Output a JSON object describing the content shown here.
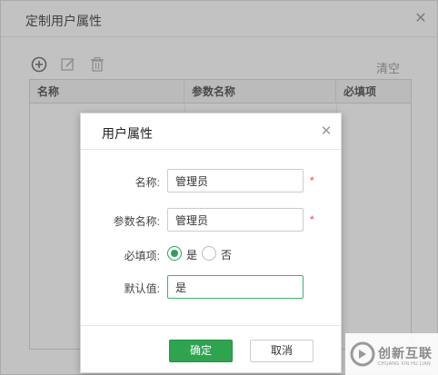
{
  "outer_dialog": {
    "title": "定制用户属性",
    "close_symbol": "✕",
    "toolbar": {
      "icons": [
        "add-circle-icon",
        "edit-icon",
        "trash-icon"
      ],
      "clear_label": "清空"
    },
    "grid": {
      "columns": [
        "名称",
        "参数名称",
        "必填项"
      ]
    }
  },
  "inner_dialog": {
    "title": "用户属性",
    "close_symbol": "✕",
    "fields": {
      "name": {
        "label": "名称:",
        "value": "管理员",
        "required_mark": "*"
      },
      "param_name": {
        "label": "参数名称:",
        "value": "管理员",
        "required_mark": "*"
      },
      "required": {
        "label": "必填项:",
        "options": [
          "是",
          "否"
        ],
        "selected": "是"
      },
      "default_value": {
        "label": "默认值:",
        "value": "是"
      }
    },
    "buttons": {
      "confirm": "确定",
      "cancel": "取消"
    }
  },
  "colors": {
    "primary": "#2ea44f",
    "radio_checked": "#2f9e5e",
    "focus_border": "#3cb371",
    "required_star": "#e44444",
    "overlay": "rgba(110,110,110,0.42)"
  },
  "watermark": {
    "text": "创新互联",
    "subtext": "CHUANG XIN HU LIAN"
  }
}
